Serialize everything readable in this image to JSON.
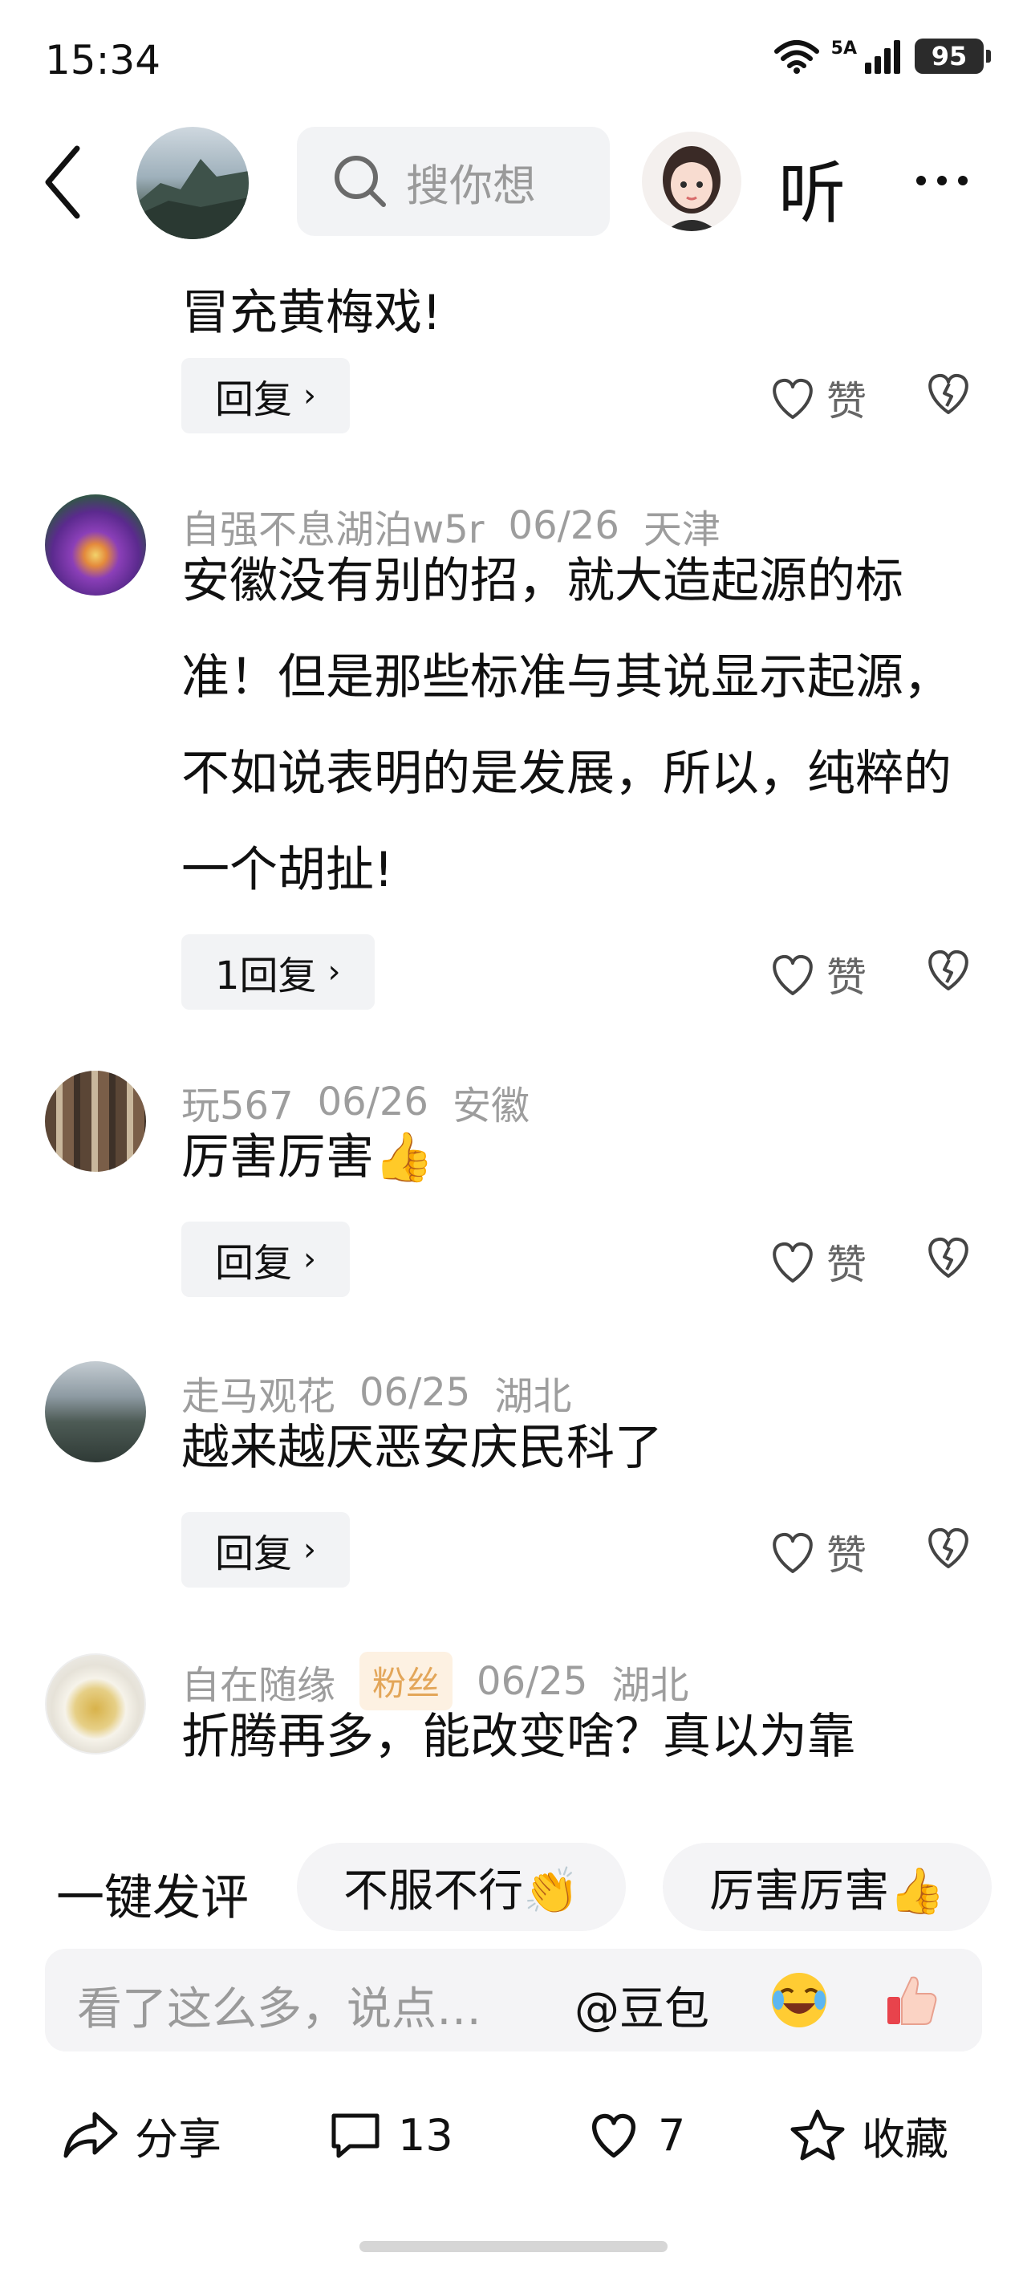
{
  "status_bar": {
    "time": "15:34",
    "network": "5A",
    "battery": "95"
  },
  "header": {
    "search_placeholder": "搜你想",
    "listen_label": "听"
  },
  "comments": [
    {
      "text": "冒充黄梅戏!",
      "reply_label": "回复",
      "like_label": "赞"
    },
    {
      "user": "自强不息湖泊w5r",
      "date": "06/26",
      "location": "天津",
      "text": "安徽没有别的招，就大造起源的标准！但是那些标准与其说显示起源，不如说表明的是发展，所以，纯粹的一个胡扯!",
      "reply_label": "1回复",
      "like_label": "赞"
    },
    {
      "user": "玩567",
      "date": "06/26",
      "location": "安徽",
      "text": "厉害厉害👍",
      "reply_label": "回复",
      "like_label": "赞"
    },
    {
      "user": "走马观花",
      "date": "06/25",
      "location": "湖北",
      "text": "越来越厌恶安庆民科了",
      "reply_label": "回复",
      "like_label": "赞"
    },
    {
      "user": "自在随缘",
      "badge": "粉丝",
      "date": "06/25",
      "location": "湖北",
      "text": "折腾再多，能改变啥？真以为靠"
    }
  ],
  "quick_comment": {
    "label": "一键发评",
    "chips": [
      "不服不行👏",
      "厉害厉害👍"
    ]
  },
  "input_bar": {
    "placeholder": "看了这么多，说点…",
    "mention": "@豆包"
  },
  "actions": {
    "share": "分享",
    "comment_count": "13",
    "like_count": "7",
    "favorite": "收藏"
  }
}
